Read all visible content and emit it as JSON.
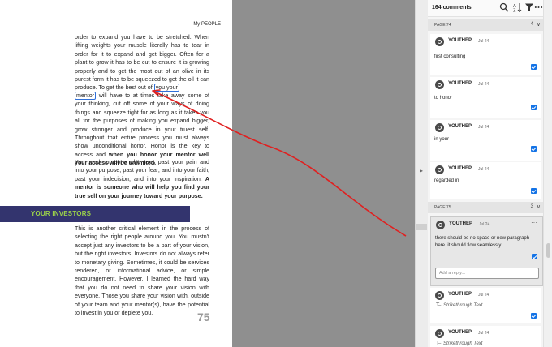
{
  "document": {
    "header": "My PEOPLE",
    "para1": "order to expand you have to be stretched. When lifting weights your muscle literally has to tear in order for it to expand and get bigger. Often for a plant to grow it has to be cut to ensure it is growing properly and to get the most out of an olive in its purest form it has to be squeezed to get the oil it can produce. To get the best out of",
    "para1_hl": "you your",
    "para2_hl": "mentor",
    "para2_rest": " will have to at times take away some of your thinking, cut off some of your ways of doing things and squeeze tight for as long as it takes you all for the purposes of making you expand bigger, grow stronger and produce in your truest self. Throughout that entire process you must always show unconditional honor. Honor is the key to access and ",
    "para2_bold": "when you honor your mentor well your access will be unlimited.",
    "para3": "You need someone who sees past your pain and into your purpose, past your fear, and into your faith, past your indecision, and into your inspiration. ",
    "para3_bold": "A mentor is someone who will help you find your true self on your journey toward your purpose.",
    "banner": "YOUR INVESTORS",
    "para4": "This is another critical element in the process of selecting the right people around you. You mustn't accept just any investors to be a part of your vision, but the right investors. Investors do not always refer to monetary giving. Sometimes, it could be services rendered, or informational advice, or simple encouragement. However, I learned the hard way that you do not need to share your vision with everyone. Those you share your vision with, outside of your team and your mentor(s), have the potential to invest in you or deplete you.",
    "page_number": "75"
  },
  "panel": {
    "count": "164 comments",
    "icons": [
      "search-icon",
      "sort-icon",
      "filter-icon",
      "more-icon"
    ],
    "page74": {
      "label": "PAGE 74",
      "count": "4",
      "chevron": "∨"
    },
    "page75": {
      "label": "PAGE 75",
      "count": "3",
      "chevron": "∨"
    },
    "comments": [
      {
        "author": "YOUTHEP",
        "date": "Jul 24",
        "text": "first consulting"
      },
      {
        "author": "YOUTHEP",
        "date": "Jul 24",
        "text": "to honor"
      },
      {
        "author": "YOUTHEP",
        "date": "Jul 24",
        "text": "in your"
      },
      {
        "author": "YOUTHEP",
        "date": "Jul 24",
        "text": "regarded in"
      },
      {
        "author": "YOUTHEP",
        "date": "Jul 24",
        "text": "there should be no space or new paragraph here. it should flow seamlessly"
      },
      {
        "author": "YOUTHEP",
        "date": "Jul 24",
        "text": "Strikethrough Text"
      },
      {
        "author": "YOUTHEP",
        "date": "Jul 24",
        "text": "Strikethrough Text"
      }
    ],
    "reply_placeholder": "Add a reply...",
    "more_glyph": "···",
    "strike_glyph": "T̶"
  },
  "colors": {
    "accent": "#1473e6",
    "arrow": "#e02020",
    "banner": "#33346e",
    "banner_text": "#9bd14a"
  }
}
